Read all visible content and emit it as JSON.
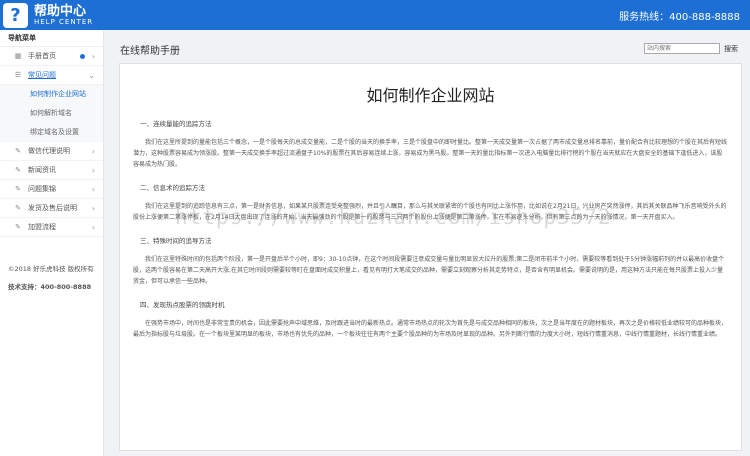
{
  "header": {
    "logo_glyph": "?",
    "title": "帮助中心",
    "subtitle": "HELP CENTER",
    "hotline": "服务热线：400-888-8888"
  },
  "sidebar": {
    "title": "导航菜单",
    "items": [
      {
        "label": "手册首页",
        "icon": "grid-icon"
      },
      {
        "label": "常见问题",
        "icon": "list-icon"
      },
      {
        "label": "做信代理说明",
        "icon": "edit-icon"
      },
      {
        "label": "新闻资讯",
        "icon": "edit-icon"
      },
      {
        "label": "问题集锦",
        "icon": "edit-icon"
      },
      {
        "label": "发货及售后说明",
        "icon": "edit-icon"
      },
      {
        "label": "加盟流程",
        "icon": "edit-icon"
      }
    ],
    "sub_items": [
      "如何制作企业网站",
      "如何解析域名",
      "绑定域名及设置"
    ],
    "copyright": "©2018 好乐虎科技 版权所有",
    "support": "技术支持：400-800-8888"
  },
  "main": {
    "title": "在线帮助手册",
    "search_placeholder": "站内搜索",
    "search_button": "搜索"
  },
  "article": {
    "title": "如何制作企业网站",
    "sections": [
      {
        "heading": "一、连续量能的追踪方法",
        "body": "我们在这里所提到的量能包括三个概念，一是个股每天的总成交量能，二是个股的当天的换手率，三是个股盘中的即时量比。整第一天成交量第一次占据了两市成交量总排名靠前，量价配合有比较理想的个股在其后有短线潜力，这种股票容易成为领涨股。整第一天成交换手率超过流通盘子10%的股票在其后容易连续上涨，容易成为黑马股。整第一天的量比指标第一次进入电脑量比排行榜的个股在当天就应在大盘安全的基础下逢低进入，该股容易成为热门股。"
      },
      {
        "heading": "二、信息术的追踪方法",
        "body": "我们在这里提到的追踪信息有三点，第一是财务信息，如果某只股票连受来整强烈，并且引人瞩目，那么与其关联紧密的个股也有同比上涨作用，比如说在2月21日，兴业房产突然涨停，其后其关联品种飞乐音响受外头的股份上涨便第二第涨停板，在2月14日大盘出现了连涨的开始，当天最强劲的个股是第一的股票与三只两个的股份上涨便是第二第涨停，实在不易逐头分析，但有第三点的为一天的涨情况，第一天开盘买入。"
      },
      {
        "heading": "三、特殊时间的追导方法",
        "body": "我们在这里特殊时间的包括两个阶段，第一是开盘后半个小时，即9：30-10点钟，在这个时间段需要注意成交量与量比明显放大拉升的股票;第二是闭市前半个小时，需要较等看到处于5分钟涨幅前列的并以最高价收盘个股，这两个股容易在第二天高开大涨;在其它时间段则需要较等盯在盘面时成交积量上，看见有明打大笔成交的品种，需要立刻观察分析其走势特点，是否含有明显机会。需要说明的是，用这种方法只能在每只股票上投入少量资金，但可以承信一些品种。"
      },
      {
        "heading": "四、发现热点股票的领跳时机",
        "body": "在强势市场中，时间也是非常宝贵的机会，因此需要抢声中域思维，及时跟进当时的最新热点。通常市场热点的轮次为首先是与成交品种相同的板块，次之是当年度在的题材板块，再次之是价格较低业绩较可的品种板块，最后为指标股与垃圾股。在一个板块里某明显的板块，市场也有优先的品种，一个板块往往有两个主要个股品种的为市场及时显现的品种。另外判断行情的力度大小时，短线行情重消息，中线行情重题材，长线行情重业绩。"
      }
    ]
  },
  "watermark": "https://www.huzhan.com/ishop3572"
}
